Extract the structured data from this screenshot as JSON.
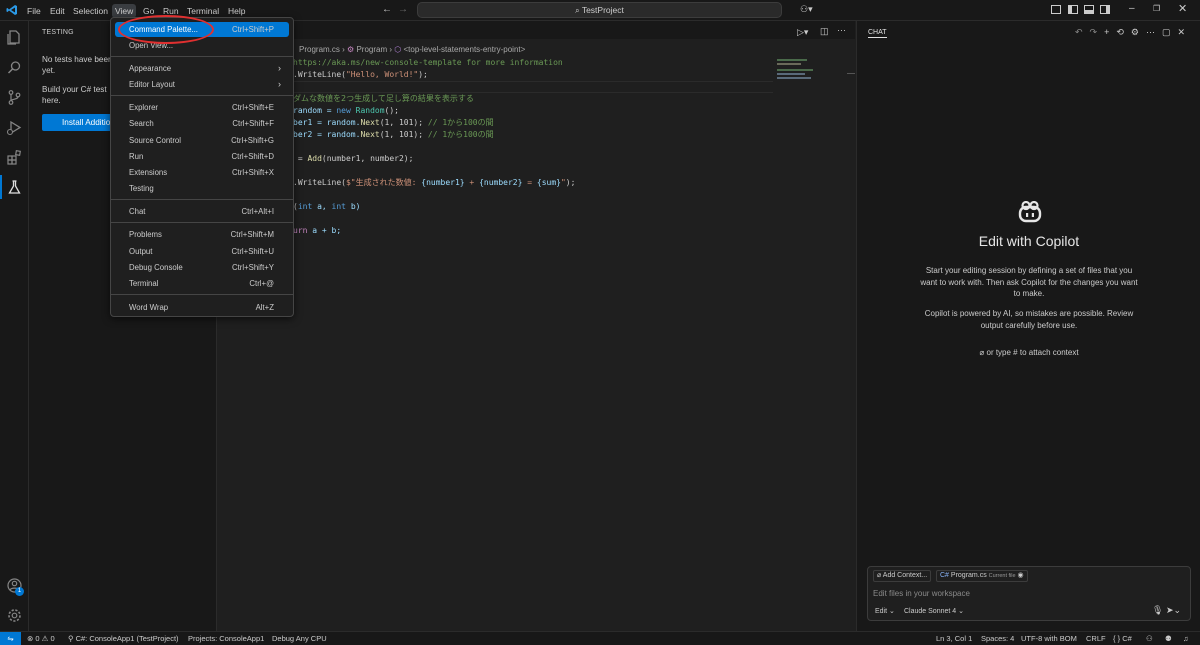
{
  "titlebar": {
    "menus": [
      "File",
      "Edit",
      "Selection",
      "View",
      "Go",
      "Run",
      "Terminal",
      "Help"
    ],
    "search_text": "TestProject"
  },
  "view_menu": {
    "items": [
      {
        "label": "Command Palette...",
        "shortcut": "Ctrl+Shift+P"
      },
      {
        "label": "Open View...",
        "shortcut": ""
      },
      {
        "label": "Appearance",
        "shortcut": ""
      },
      {
        "label": "Editor Layout",
        "shortcut": ""
      },
      {
        "label": "Explorer",
        "shortcut": "Ctrl+Shift+E"
      },
      {
        "label": "Search",
        "shortcut": "Ctrl+Shift+F"
      },
      {
        "label": "Source Control",
        "shortcut": "Ctrl+Shift+G"
      },
      {
        "label": "Run",
        "shortcut": "Ctrl+Shift+D"
      },
      {
        "label": "Extensions",
        "shortcut": "Ctrl+Shift+X"
      },
      {
        "label": "Testing",
        "shortcut": ""
      },
      {
        "label": "Chat",
        "shortcut": "Ctrl+Alt+I"
      },
      {
        "label": "Problems",
        "shortcut": "Ctrl+Shift+M"
      },
      {
        "label": "Output",
        "shortcut": "Ctrl+Shift+U"
      },
      {
        "label": "Debug Console",
        "shortcut": "Ctrl+Shift+Y"
      },
      {
        "label": "Terminal",
        "shortcut": "Ctrl+@"
      },
      {
        "label": "Word Wrap",
        "shortcut": "Alt+Z"
      }
    ]
  },
  "sidebar": {
    "title": "TESTING",
    "text1_line1": "No tests have been",
    "text1_line2": "yet.",
    "text2_line1": "Build your C# test",
    "text2_line2": "here.",
    "install_button": "Install Additio"
  },
  "editor": {
    "breadcrumb": {
      "file": "Program.cs",
      "class": "Program",
      "member": "<top-level-statements-entry-point>"
    },
    "lines": {
      "l1_link": "https://aka.ms/new-console-template",
      "l1_rest": " for more information",
      "l2_a": ".WriteLine(",
      "l2_str": "\"Hello, World!\"",
      "l2_b": ");",
      "l4": "ダムな数値を2つ生成して足し算の結果を表示する",
      "l5_a": "random = ",
      "l5_kw": "new",
      "l5_ty": " Random",
      "l5_b": "();",
      "l6_a": "ber1 = random.",
      "l6_fn": "Next",
      "l6_b": "(1, 101); ",
      "l6_cm": "// 1から100の間",
      "l7_a": "ber2 = random.",
      "l7_fn": "Next",
      "l7_b": "(1, 101); ",
      "l7_cm": "// 1から100の間",
      "l9_a": " = ",
      "l9_fn": "Add",
      "l9_b": "(number1, number2);",
      "l11_a": ".WriteLine(",
      "l11_str1": "$\"生成された数値: ",
      "l11_v1": "{number1}",
      "l11_s2": " + ",
      "l11_v2": "{number2}",
      "l11_s3": " = ",
      "l11_v3": "{sum}",
      "l11_s4": "\"",
      "l11_b": ");",
      "l13_a": "(",
      "l13_kw1": "int",
      "l13_b": " a, ",
      "l13_kw2": "int",
      "l13_c": " b)",
      "l15_kw": "urn",
      "l15_b": " a + b;"
    }
  },
  "chat": {
    "tab": "CHAT",
    "heading": "Edit with Copilot",
    "desc": "Start your editing session by defining a set of files that you want to work with. Then ask Copilot for the changes you want to make.",
    "desc2": "Copilot is powered by AI, so mistakes are possible. Review output carefully before use.",
    "attach_hint": "or type # to attach context",
    "add_context": "Add Context...",
    "file_chip": "Program.cs",
    "file_chip_sub": "Current file",
    "placeholder": "Edit files in your workspace",
    "mode": "Edit",
    "model": "Claude Sonnet 4"
  },
  "statusbar": {
    "errors": "0",
    "warnings": "0",
    "project": "C#: ConsoleApp1 (TestProject)",
    "projects": "Projects: ConsoleApp1",
    "debug": "Debug Any CPU",
    "position": "Ln 3, Col 1",
    "spaces": "Spaces: 4",
    "encoding": "UTF-8 with BOM",
    "eol": "CRLF",
    "language": "C#"
  },
  "accounts_badge": "1",
  "colors": {
    "accent": "#0078d4",
    "highlight_ring": "#e03030"
  }
}
